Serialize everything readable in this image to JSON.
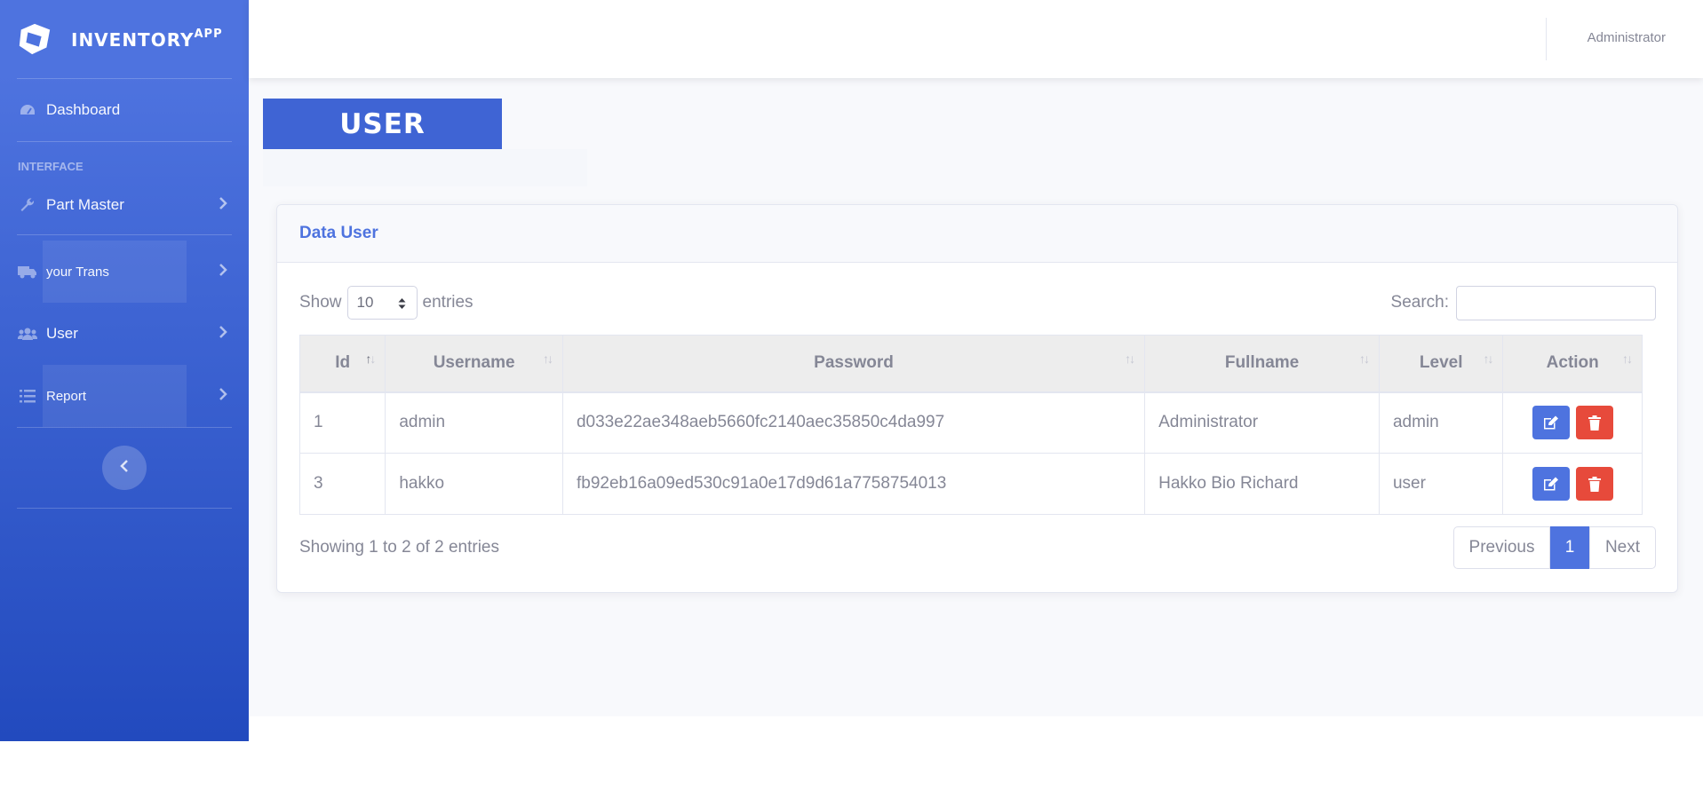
{
  "brand": {
    "name": "INVENTORY",
    "sup": "APP"
  },
  "sidebar": {
    "dashboard": "Dashboard",
    "heading": "INTERFACE",
    "items": [
      {
        "label": "Part Master",
        "icon": "wrench-icon"
      },
      {
        "label": "your Trans",
        "icon": "truck-icon"
      },
      {
        "label": "User",
        "icon": "users-icon"
      },
      {
        "label": "Report",
        "icon": "list-icon"
      }
    ]
  },
  "topbar": {
    "user": "Administrator"
  },
  "page": {
    "title": "USER"
  },
  "card": {
    "title": "Data User",
    "show_label": "Show",
    "entries_label": "entries",
    "length_value": "10",
    "search_label": "Search:",
    "search_value": ""
  },
  "table": {
    "headers": [
      "Id",
      "Username",
      "Password",
      "Fullname",
      "Level",
      "Action"
    ],
    "rows": [
      {
        "id": "1",
        "username": "admin",
        "password": "d033e22ae348aeb5660fc2140aec35850c4da997",
        "fullname": "Administrator",
        "level": "admin"
      },
      {
        "id": "3",
        "username": "hakko",
        "password": "fb92eb16a09ed530c91a0e17d9d61a7758754013",
        "fullname": "Hakko Bio Richard",
        "level": "user"
      }
    ]
  },
  "footer": {
    "info": "Showing 1 to 2 of 2 entries",
    "previous": "Previous",
    "current_page": "1",
    "next": "Next"
  },
  "colors": {
    "primary": "#4e73df",
    "danger": "#e74a3b"
  }
}
